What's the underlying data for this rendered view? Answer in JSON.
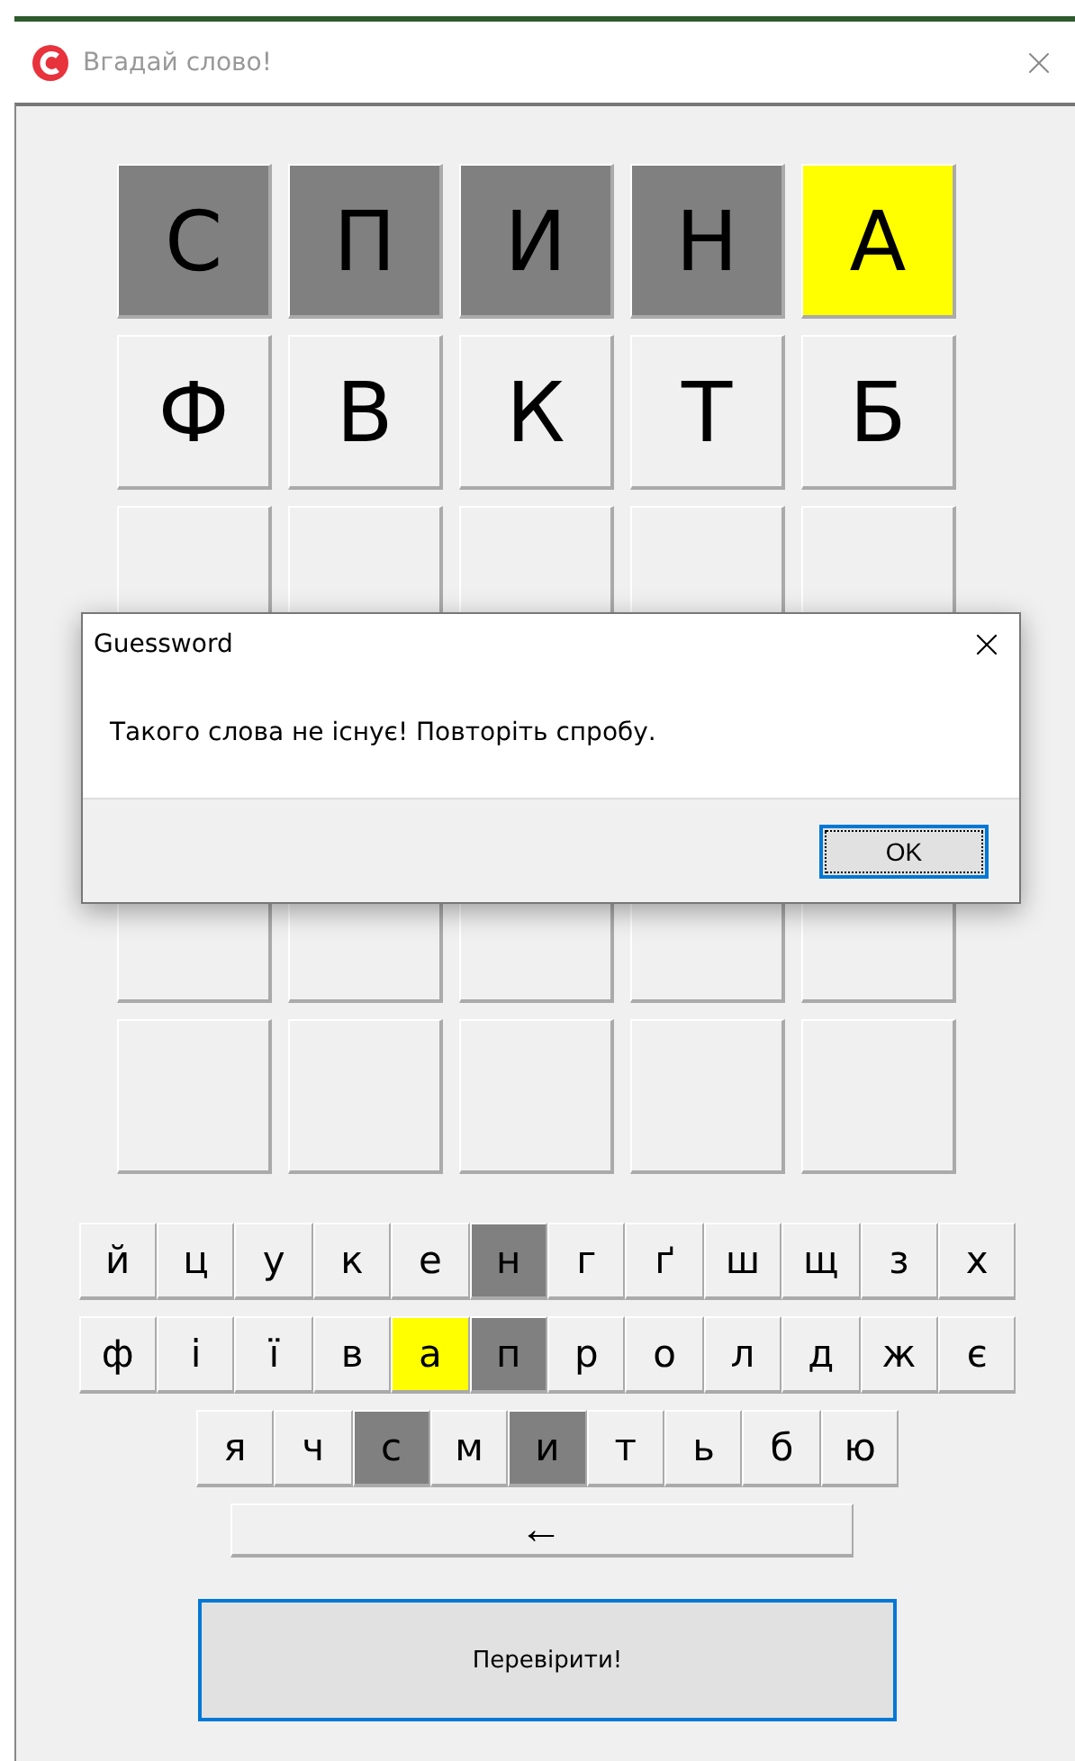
{
  "window": {
    "title": "Вгадай слово!"
  },
  "grid": [
    [
      {
        "letter": "С",
        "kind": "absent"
      },
      {
        "letter": "П",
        "kind": "absent"
      },
      {
        "letter": "И",
        "kind": "absent"
      },
      {
        "letter": "Н",
        "kind": "absent"
      },
      {
        "letter": "А",
        "kind": "present"
      }
    ],
    [
      {
        "letter": "Ф",
        "kind": "pending"
      },
      {
        "letter": "В",
        "kind": "pending"
      },
      {
        "letter": "К",
        "kind": "pending"
      },
      {
        "letter": "Т",
        "kind": "pending"
      },
      {
        "letter": "Б",
        "kind": "pending"
      }
    ],
    [
      {
        "kind": "empty"
      },
      {
        "kind": "empty"
      },
      {
        "kind": "empty"
      },
      {
        "kind": "empty"
      },
      {
        "kind": "empty"
      }
    ],
    [
      {
        "kind": "empty"
      },
      {
        "kind": "empty"
      },
      {
        "kind": "empty"
      },
      {
        "kind": "empty"
      },
      {
        "kind": "empty"
      }
    ],
    [
      {
        "kind": "empty"
      },
      {
        "kind": "empty"
      },
      {
        "kind": "empty"
      },
      {
        "kind": "empty"
      },
      {
        "kind": "empty"
      }
    ]
  ],
  "keyboard": {
    "rows": [
      [
        {
          "label": "й",
          "kind": "unused"
        },
        {
          "label": "ц",
          "kind": "unused"
        },
        {
          "label": "у",
          "kind": "unused"
        },
        {
          "label": "к",
          "kind": "unused"
        },
        {
          "label": "е",
          "kind": "unused"
        },
        {
          "label": "н",
          "kind": "absent"
        },
        {
          "label": "г",
          "kind": "unused"
        },
        {
          "label": "ґ",
          "kind": "unused"
        },
        {
          "label": "ш",
          "kind": "unused"
        },
        {
          "label": "щ",
          "kind": "unused"
        },
        {
          "label": "з",
          "kind": "unused"
        },
        {
          "label": "х",
          "kind": "unused"
        }
      ],
      [
        {
          "label": "ф",
          "kind": "unused"
        },
        {
          "label": "і",
          "kind": "unused"
        },
        {
          "label": "ї",
          "kind": "unused"
        },
        {
          "label": "в",
          "kind": "unused"
        },
        {
          "label": "а",
          "kind": "present"
        },
        {
          "label": "п",
          "kind": "absent"
        },
        {
          "label": "р",
          "kind": "unused"
        },
        {
          "label": "о",
          "kind": "unused"
        },
        {
          "label": "л",
          "kind": "unused"
        },
        {
          "label": "д",
          "kind": "unused"
        },
        {
          "label": "ж",
          "kind": "unused"
        },
        {
          "label": "є",
          "kind": "unused"
        }
      ],
      [
        {
          "label": "я",
          "kind": "unused"
        },
        {
          "label": "ч",
          "kind": "unused"
        },
        {
          "label": "с",
          "kind": "absent"
        },
        {
          "label": "м",
          "kind": "unused"
        },
        {
          "label": "и",
          "kind": "absent"
        },
        {
          "label": "т",
          "kind": "unused"
        },
        {
          "label": "ь",
          "kind": "unused"
        },
        {
          "label": "б",
          "kind": "unused"
        },
        {
          "label": "ю",
          "kind": "unused"
        }
      ]
    ],
    "backspace": {
      "label": "←"
    }
  },
  "check_button": {
    "label": "Перевірити!"
  },
  "dialog": {
    "title": "Guessword",
    "message": "Такого слова не існує! Повторіть спробу.",
    "button": {
      "label": "OK",
      "focused": true
    }
  }
}
